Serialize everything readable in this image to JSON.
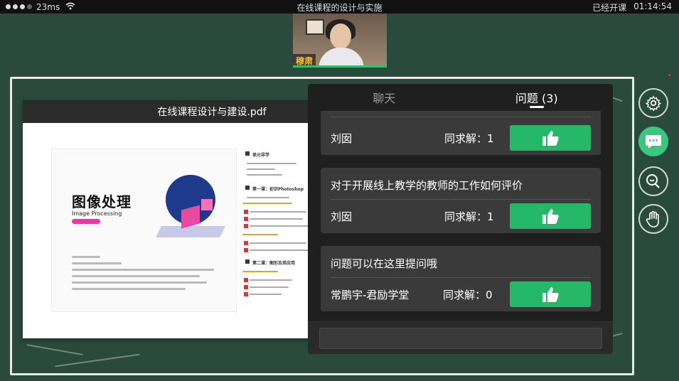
{
  "status_bar": {
    "latency": "23ms",
    "course_title": "在线课程的设计与实施",
    "class_status": "已经开课",
    "elapsed": "01:14:54",
    "wifi_icon": "wifi-icon"
  },
  "teacher": {
    "name_tag": "穆肃"
  },
  "pdf": {
    "filename": "在线课程设计与建设.pdf",
    "cover_title": "图像处理",
    "cover_subtitle": "Image Processing",
    "toc": {
      "unit_heading": "单元导学",
      "lesson1": "第一课：初识Photoshop",
      "lesson2": "第二课：图形及其应用"
    }
  },
  "qa": {
    "tabs": [
      {
        "label": "聊天",
        "active": false
      },
      {
        "label": "问题 (3)",
        "active": true
      }
    ],
    "count_label": "同求解：",
    "questions": [
      {
        "text": "",
        "author": "刘囡",
        "count": "1"
      },
      {
        "text": "对于开展线上教学的教师的工作如何评价",
        "author": "刘囡",
        "count": "1"
      },
      {
        "text": "问题可以在这里提问哦",
        "author": "常鹏宇-君励学堂",
        "count": "0"
      }
    ],
    "like_icon": "thumbs-up-icon",
    "accent_color": "#25b868"
  },
  "toolbar": {
    "items": [
      "gear-icon",
      "chat-bubble-icon",
      "qa-icon",
      "raise-hand-icon"
    ],
    "active_color": "#3cc67c"
  }
}
